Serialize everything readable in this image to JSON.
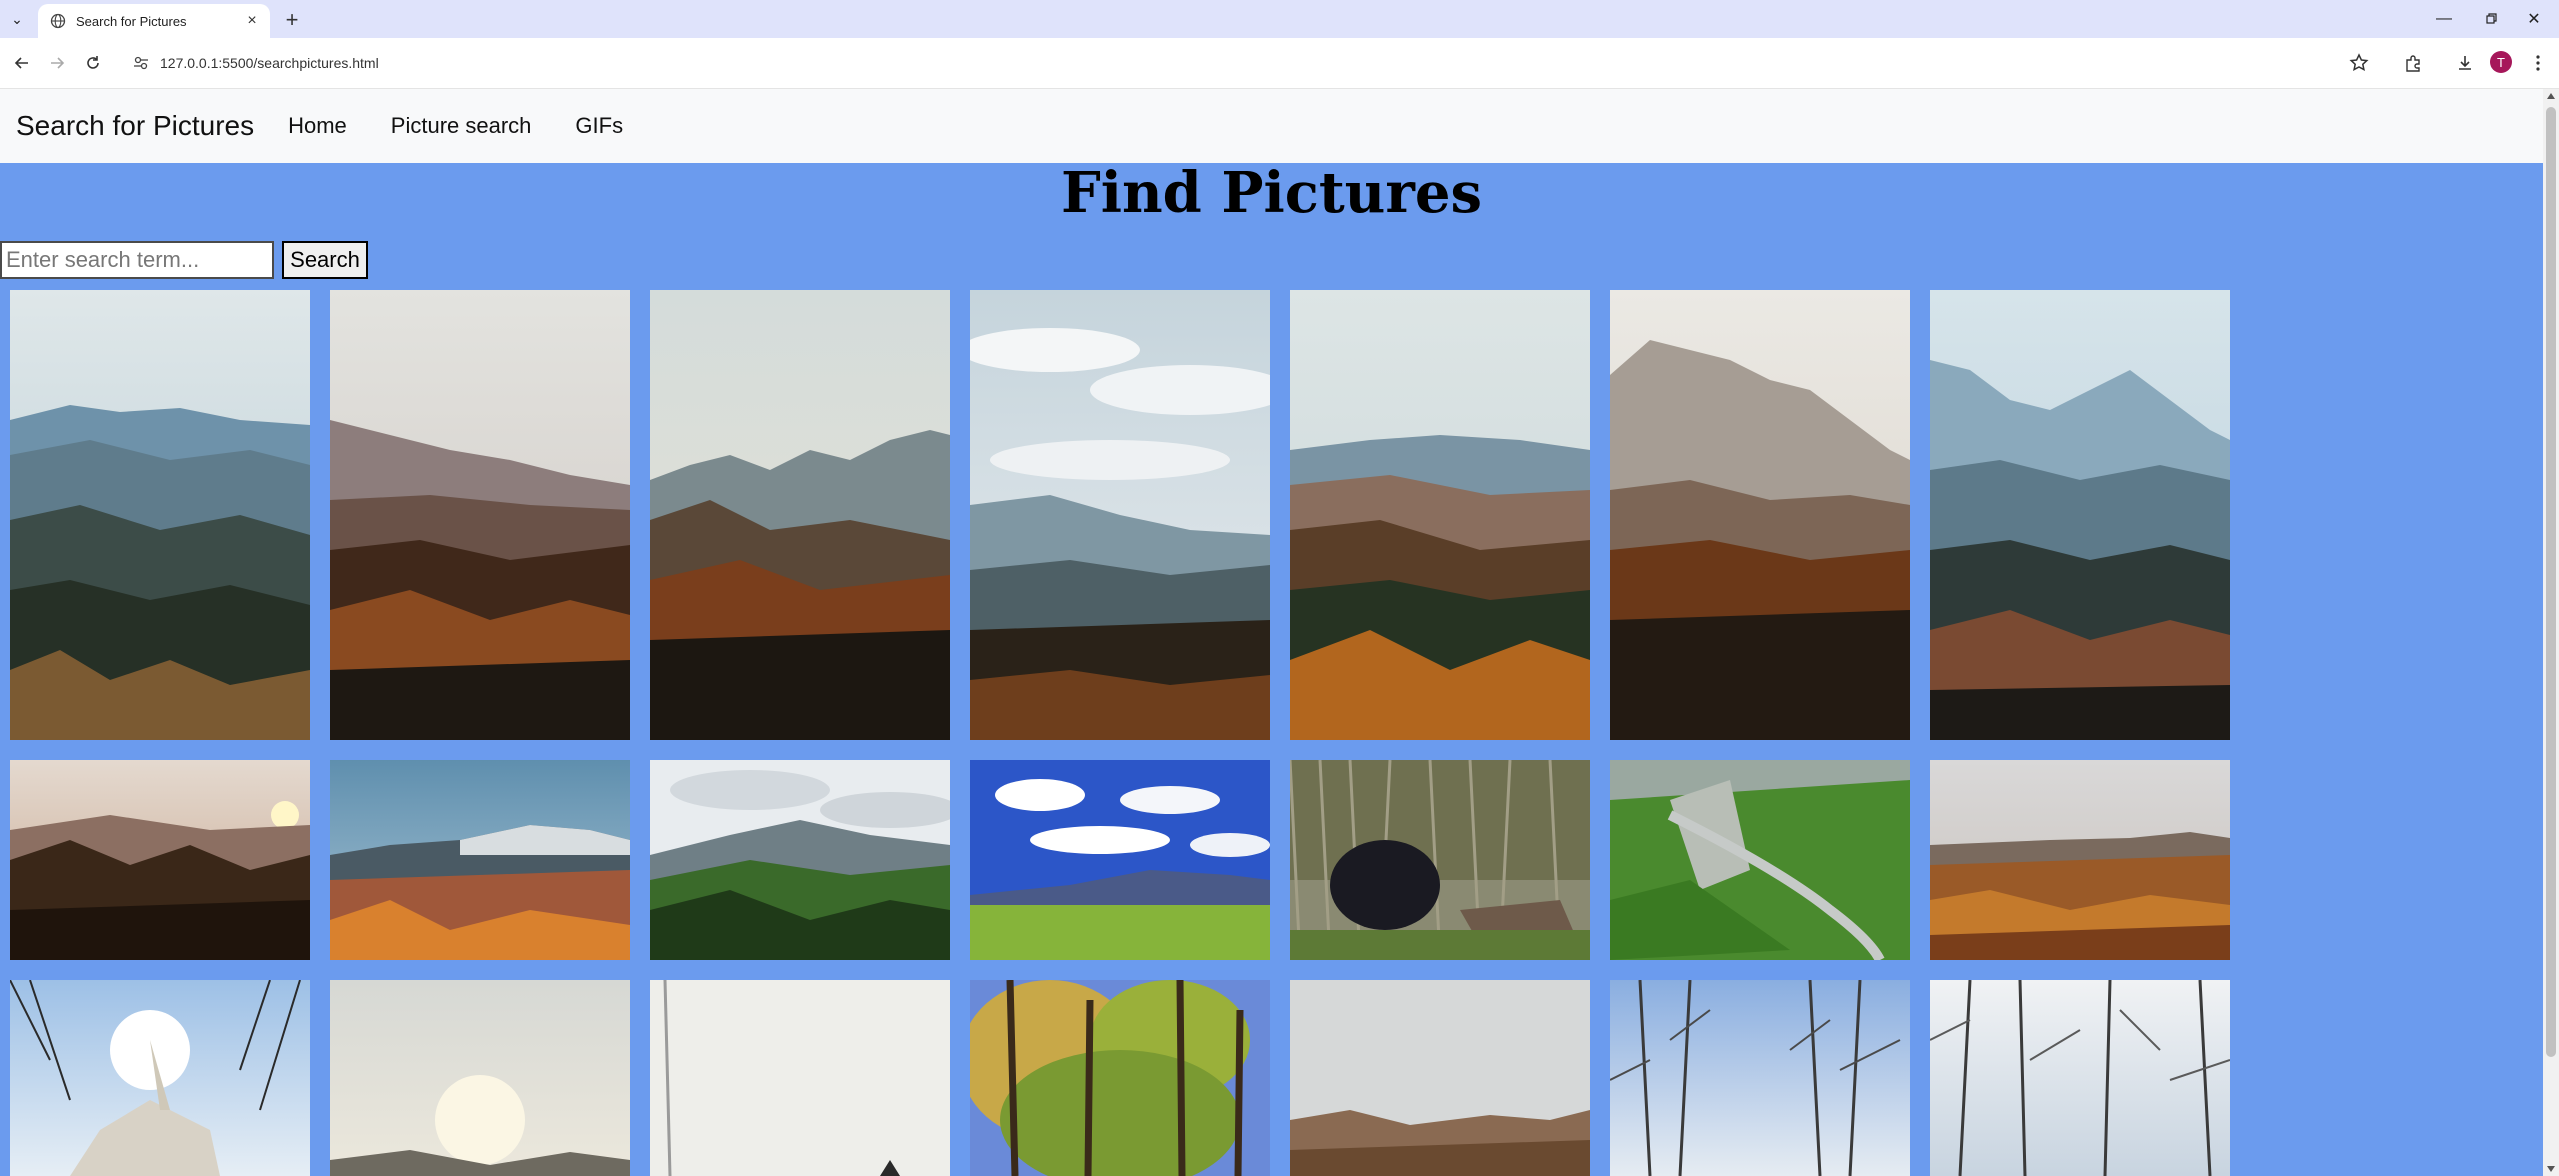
{
  "browser": {
    "tab_title": "Search for Pictures",
    "url": "127.0.0.1:5500/searchpictures.html",
    "profile_initial": "T"
  },
  "nav": {
    "brand": "Search for Pictures",
    "links": [
      "Home",
      "Picture search",
      "GIFs"
    ]
  },
  "main": {
    "title": "Find Pictures",
    "search_placeholder": "Enter search term...",
    "search_button": "Search"
  },
  "gallery": {
    "rows": [
      [
        "mountain-ridge",
        "mountain-haze",
        "mountain-peaks",
        "cloudy-mountains",
        "autumn-valley",
        "sunlit-peak",
        "blue-ridge"
      ],
      [
        "forest-sunset",
        "snowy-peak",
        "green-hills",
        "blue-sky-meadow",
        "black-bear",
        "winding-road",
        "autumn-plateau"
      ],
      [
        "church-steeple",
        "bright-sky",
        "pale-sky",
        "autumn-trees",
        "hazy-hills",
        "bare-trees",
        "bare-branches"
      ]
    ]
  }
}
